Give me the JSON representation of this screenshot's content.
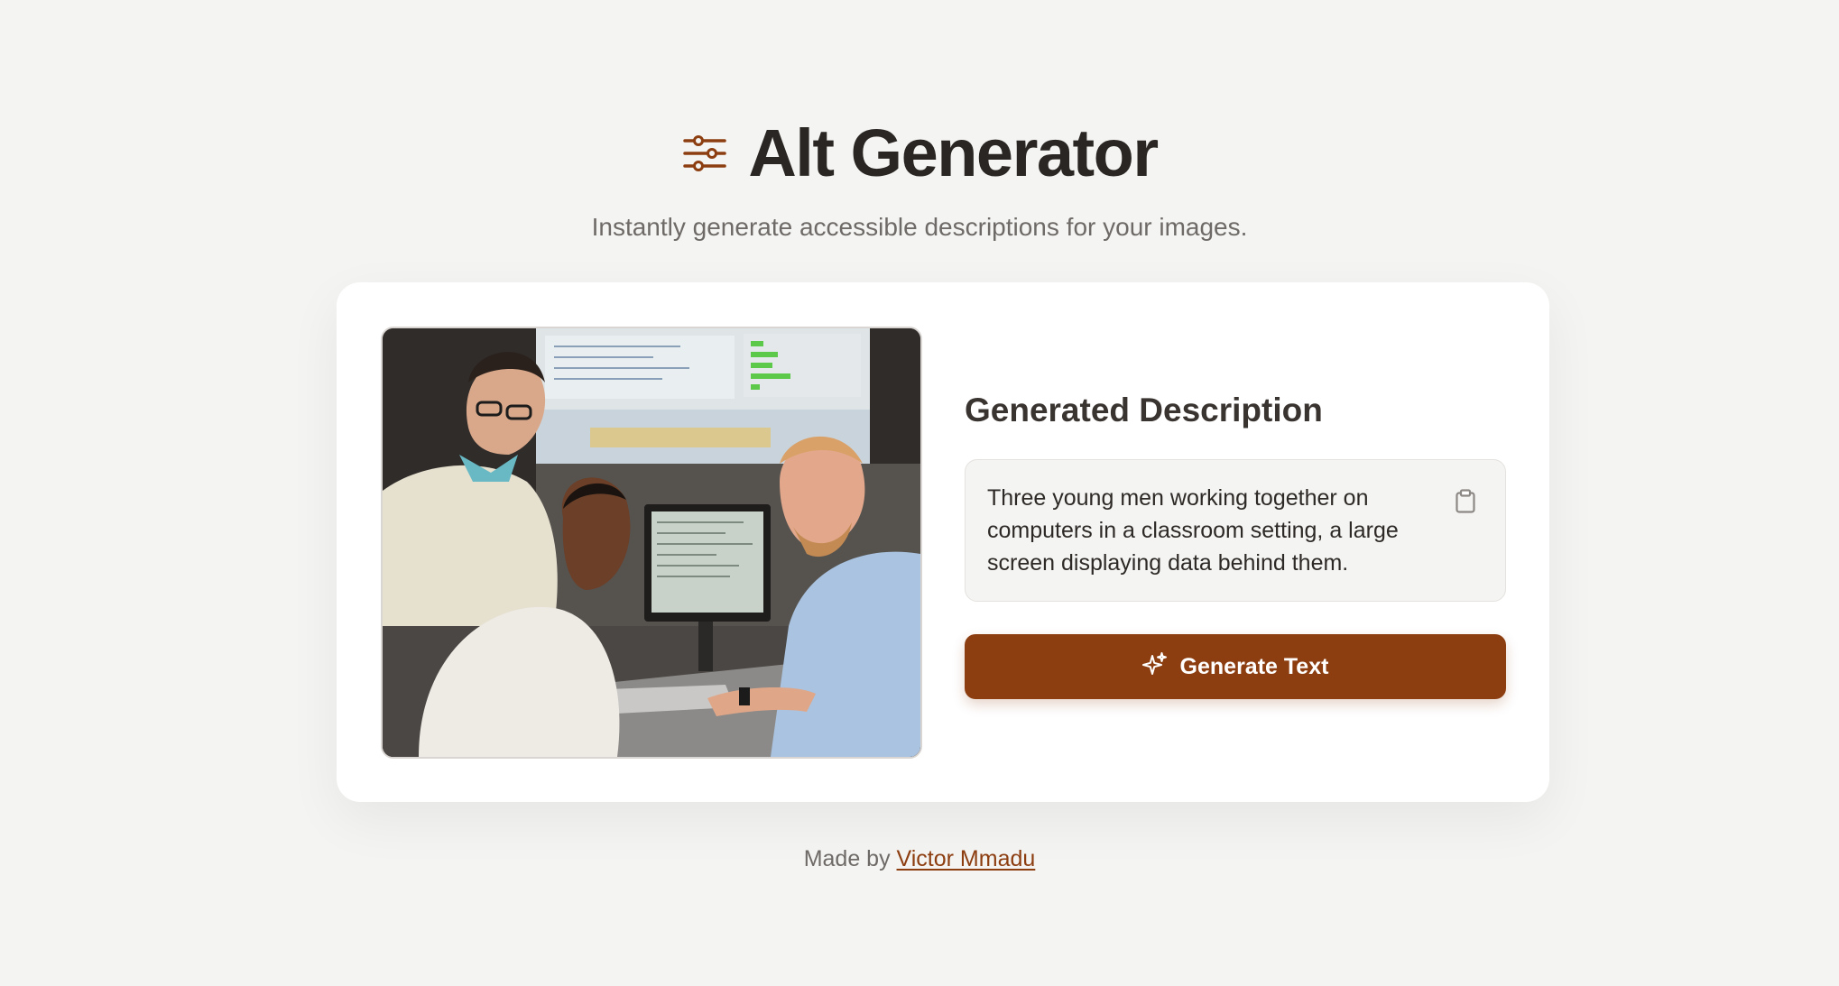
{
  "header": {
    "icon": "sliders-icon",
    "title": "Alt Generator",
    "subtitle": "Instantly generate accessible descriptions for your images."
  },
  "main": {
    "image": {
      "icon": "uploaded-photo"
    },
    "section_title": "Generated Description",
    "description": "Three young men working together on computers in a classroom setting, a large screen displaying data behind them.",
    "copy_icon": "clipboard-icon",
    "generate_button": {
      "icon": "sparkles-icon",
      "label": "Generate Text"
    }
  },
  "footer": {
    "prefix": "Made by",
    "author": "Victor Mmadu"
  },
  "colors": {
    "background": "#f4f4f2",
    "accent": "#8d3e11",
    "card": "#ffffff",
    "text": "#2a2623",
    "muted": "#6e6a67"
  }
}
